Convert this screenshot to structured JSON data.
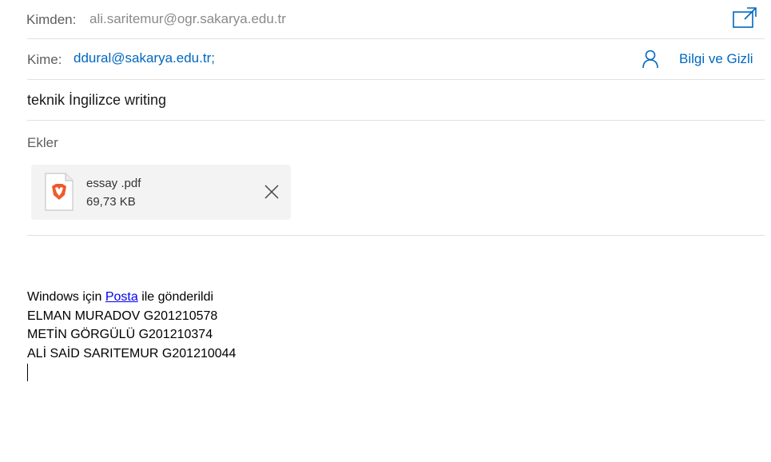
{
  "header": {
    "from_label": "Kimden:",
    "from_value": "ali.saritemur@ogr.sakarya.edu.tr",
    "to_label": "Kime:",
    "to_value": "ddural@sakarya.edu.tr;",
    "bcc_label": "Bilgi ve Gizli",
    "subject": "teknik İngilizce writing"
  },
  "attachments": {
    "label": "Ekler",
    "items": [
      {
        "name": "essay .pdf",
        "size": "69,73 KB",
        "icon": "brave-pdf-file-icon"
      }
    ]
  },
  "body": {
    "sent_prefix": "Windows için",
    "sent_link": "Posta",
    "sent_suffix": "ile gönderildi",
    "lines": [
      "ELMAN MURADOV G201210578",
      "METİN GÖRGÜLÜ G201210374",
      "ALİ SAİD SARITEMUR G201210044"
    ]
  },
  "colors": {
    "accent": "#0067c0",
    "link": "#0000ee",
    "card_bg": "#f3f3f3",
    "divider": "#e1e1e1"
  }
}
